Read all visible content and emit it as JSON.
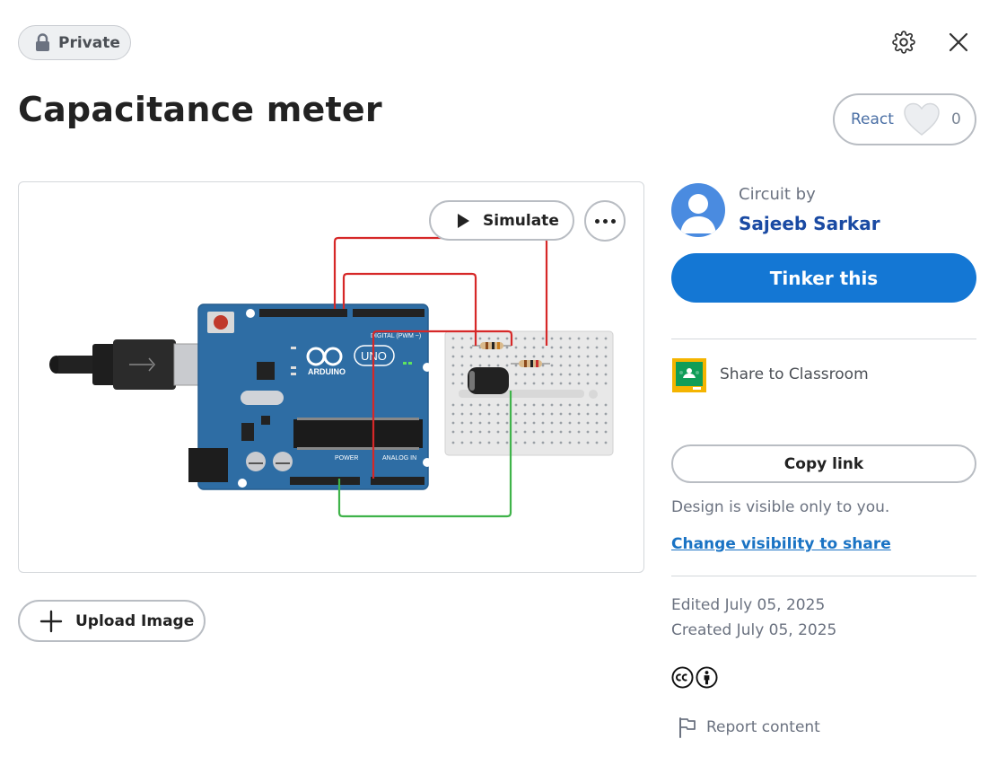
{
  "header": {
    "privacy_label": "Private",
    "title": "Capacitance meter"
  },
  "react": {
    "label": "React",
    "count": "0"
  },
  "preview": {
    "simulate_label": "Simulate"
  },
  "upload": {
    "label": "Upload Image"
  },
  "author": {
    "caption": "Circuit by",
    "name": "Sajeeb Sarkar"
  },
  "actions": {
    "tinker_label": "Tinker this",
    "classroom_label": "Share to Classroom",
    "copy_link_label": "Copy link"
  },
  "visibility": {
    "note": "Design is visible only to you.",
    "link": "Change visibility to share"
  },
  "meta": {
    "edited": "Edited July 05, 2025",
    "created": "Created July 05, 2025"
  },
  "report": {
    "label": "Report content"
  },
  "colors": {
    "primary": "#1477d4",
    "author_link": "#1a4aa3",
    "arduino_board": "#2e6da4",
    "wire_red": "#d62828",
    "wire_green": "#3fb34a"
  },
  "icons": [
    "lock-icon",
    "gear-icon",
    "close-icon",
    "heart-icon",
    "play-icon",
    "more-icon",
    "plus-icon",
    "avatar-icon",
    "classroom-icon",
    "cc-icon",
    "attribution-icon",
    "flag-icon"
  ]
}
